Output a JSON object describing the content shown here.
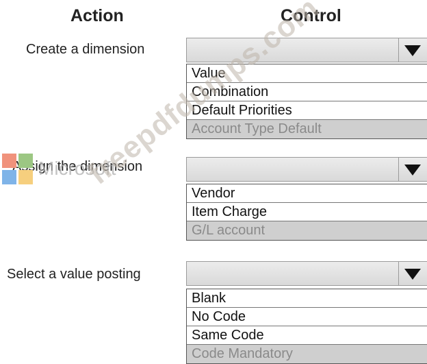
{
  "headers": {
    "action": "Action",
    "control": "Control"
  },
  "rows": [
    {
      "action": "Create a dimension",
      "options": [
        "Value",
        "Combination",
        "Default Priorities",
        "Account Type Default"
      ]
    },
    {
      "action": "Assign the dimension",
      "options": [
        "Vendor",
        "Item Charge",
        "G/L account"
      ]
    },
    {
      "action": "Select a value posting",
      "options": [
        "Blank",
        "No Code",
        "Same Code",
        "Code Mandatory"
      ]
    }
  ],
  "watermark": {
    "text": "freepdfdumps.com",
    "logo_text": "Microsoft",
    "logo_icon": "microsoft-logo-icon",
    "logo_colors": [
      "#f0927c",
      "#9cc783",
      "#7fb4e8",
      "#f6cf7e"
    ]
  },
  "icons": {
    "dropdown_arrow": "chevron-down-icon"
  }
}
